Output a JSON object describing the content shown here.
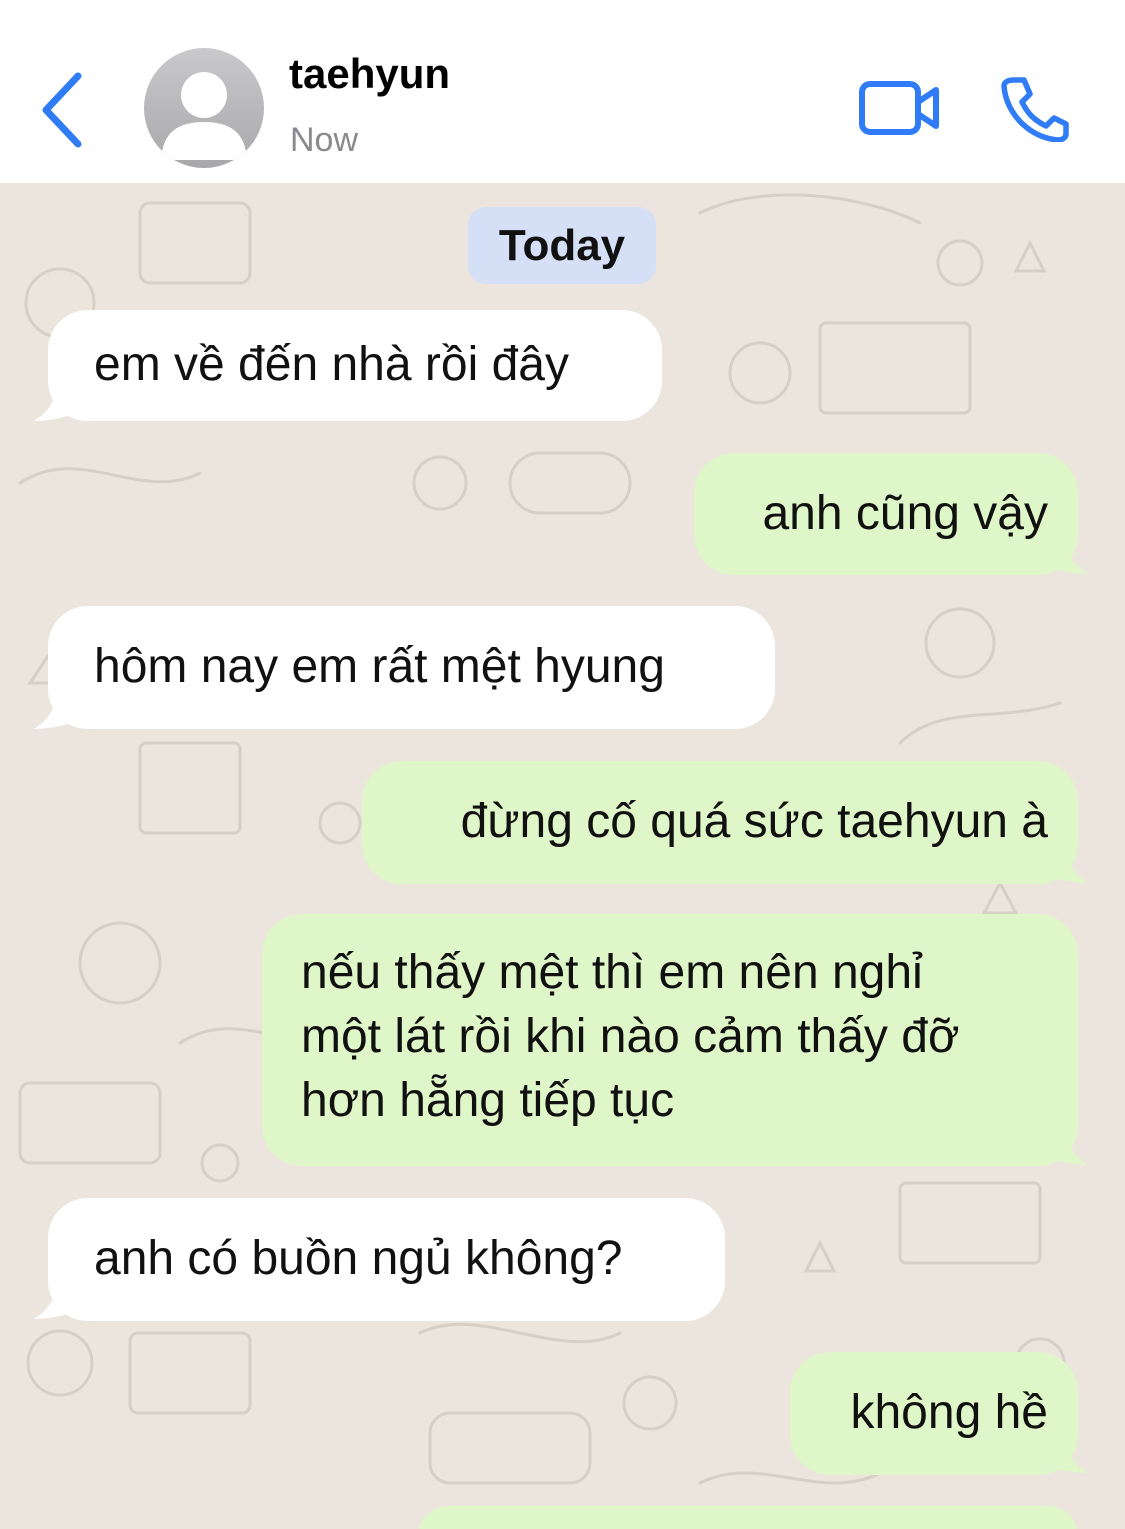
{
  "header": {
    "contact_name": "taehyun",
    "status": "Now",
    "icons": {
      "back": "chevron-left-icon",
      "avatar": "person-icon",
      "video": "video-camera-icon",
      "phone": "phone-icon"
    },
    "accent_color": "#2f7cf6"
  },
  "chat": {
    "date_label": "Today",
    "background_color": "#ece5dd",
    "incoming_color": "#ffffff",
    "outgoing_color": "#dff6c9",
    "messages": [
      {
        "direction": "incoming",
        "text": "em về đến nhà rồi đây"
      },
      {
        "direction": "outgoing",
        "text": "anh cũng vậy"
      },
      {
        "direction": "incoming",
        "text": "hôm nay em rất mệt hyung"
      },
      {
        "direction": "outgoing",
        "text": "đừng cố quá sức taehyun à"
      },
      {
        "direction": "outgoing",
        "lines": [
          "nếu thấy mệt thì em nên nghỉ",
          "một lát rồi khi nào cảm thấy đỡ",
          "hơn hẵng tiếp tục"
        ]
      },
      {
        "direction": "incoming",
        "text": "anh có buồn ngủ không?"
      },
      {
        "direction": "outgoing",
        "text": "không hề"
      }
    ]
  }
}
